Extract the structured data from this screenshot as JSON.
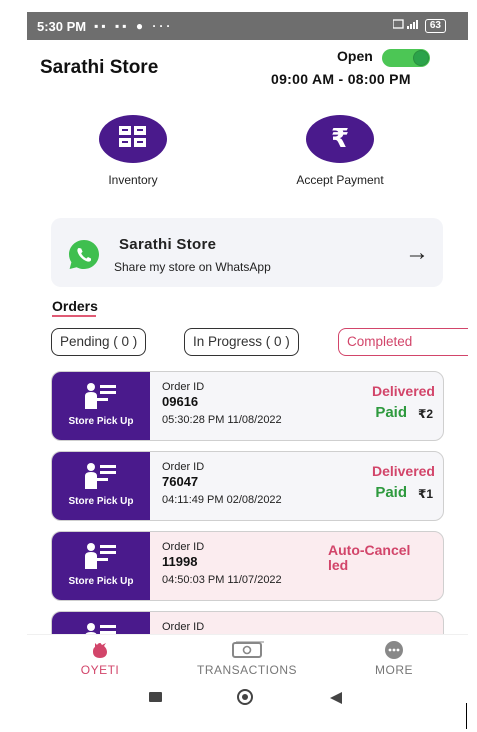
{
  "status_bar": {
    "time": "5:30 PM",
    "icons": "▪▪ ▪▪ ● ···",
    "battery": "63"
  },
  "header": {
    "store_name": "Sarathi Store",
    "open_label": "Open",
    "hours": "09:00 AM - 08:00 PM",
    "open": true
  },
  "actions": [
    {
      "label": "Inventory",
      "icon": "inventory-icon"
    },
    {
      "label": "Accept Payment",
      "icon": "rupee-icon"
    }
  ],
  "whatsapp_card": {
    "title": "Sarathi Store",
    "subtitle": "Share my store on WhatsApp",
    "icon": "whatsapp-icon",
    "arrow": "→"
  },
  "orders": {
    "heading": "Orders",
    "tabs": [
      {
        "label": "Pending ( 0 )",
        "active": false
      },
      {
        "label": "In Progress ( 0 )",
        "active": false
      },
      {
        "label": "Completed",
        "active": true
      }
    ],
    "list": [
      {
        "type": "Store Pick Up",
        "id_label": "Order ID",
        "id": "09616",
        "datetime": "05:30:28 PM 11/08/2022",
        "status": "Delivered",
        "paid": "Paid",
        "amount": "₹2"
      },
      {
        "type": "Store Pick Up",
        "id_label": "Order ID",
        "id": "76047",
        "datetime": "04:11:49 PM 02/08/2022",
        "status": "Delivered",
        "paid": "Paid",
        "amount": "₹1"
      },
      {
        "type": "Store Pick Up",
        "id_label": "Order ID",
        "id": "11998",
        "datetime": "04:50:03 PM 11/07/2022",
        "status": "Auto-Cancel\nled",
        "paid": "",
        "amount": ""
      },
      {
        "type": "",
        "id_label": "Order ID",
        "id": "",
        "datetime": "",
        "status": "",
        "paid": "",
        "amount": ""
      }
    ]
  },
  "bottom_nav": [
    {
      "label": "OYETI",
      "icon": "oyeti-icon",
      "active": true
    },
    {
      "label": "TRANSACTIONS",
      "icon": "cash-icon",
      "active": false
    },
    {
      "label": "MORE",
      "icon": "more-icon",
      "active": false
    }
  ],
  "colors": {
    "primary": "#4a1a8c",
    "accent": "#d2456a",
    "paid": "#2e9a3e",
    "toggle": "#4cc655"
  }
}
